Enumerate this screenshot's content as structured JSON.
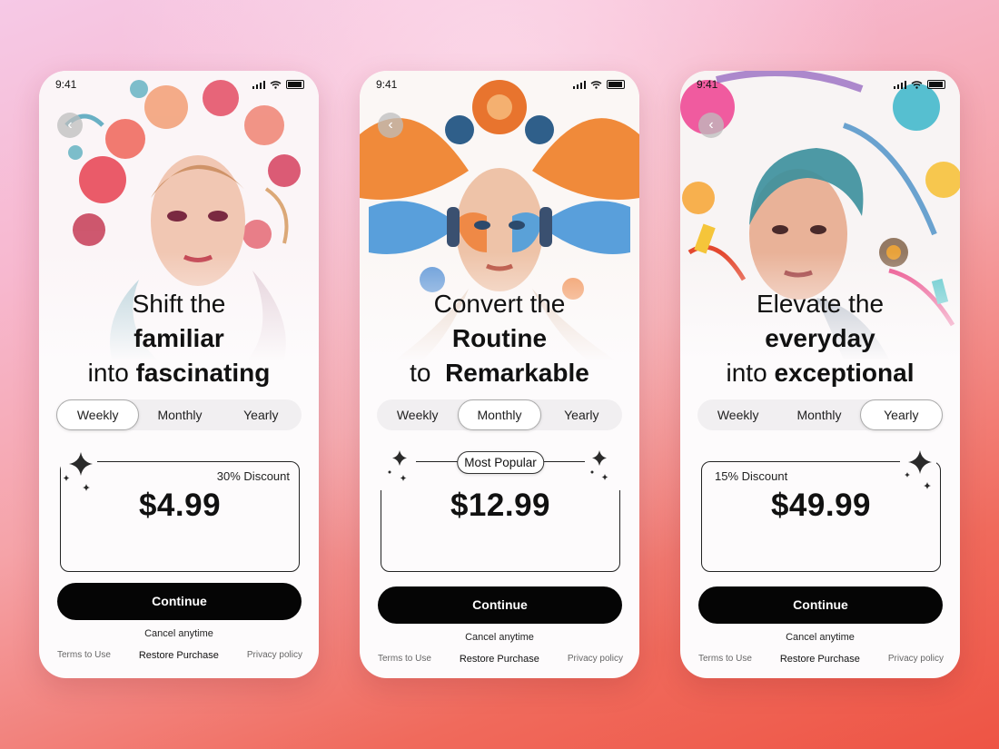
{
  "screens": [
    {
      "time": "9:41",
      "headline": {
        "line1": "Shift the",
        "line2": "familiar",
        "line3_pre": "into",
        "line3_bold": "fascinating"
      },
      "tabs": [
        "Weekly",
        "Monthly",
        "Yearly"
      ],
      "selected_tab": "Weekly",
      "discount": "30% Discount",
      "price": "$4.99",
      "cta": "Continue",
      "cancel": "Cancel anytime",
      "footer": {
        "terms": "Terms to Use",
        "restore": "Restore Purchase",
        "privacy": "Privacy policy"
      }
    },
    {
      "time": "9:41",
      "headline": {
        "line1": "Convert the",
        "line2": "Routine",
        "line3_pre": "to",
        "line3_bold": "Remarkable"
      },
      "tabs": [
        "Weekly",
        "Monthly",
        "Yearly"
      ],
      "selected_tab": "Monthly",
      "badge": "Most Popular",
      "price": "$12.99",
      "cta": "Continue",
      "cancel": "Cancel anytime",
      "footer": {
        "terms": "Terms to Use",
        "restore": "Restore Purchase",
        "privacy": "Privacy policy"
      }
    },
    {
      "time": "9:41",
      "headline": {
        "line1": "Elevate the",
        "line2": "everyday",
        "line3_pre": "into",
        "line3_bold": "exceptional"
      },
      "tabs": [
        "Weekly",
        "Monthly",
        "Yearly"
      ],
      "selected_tab": "Yearly",
      "discount": "15% Discount",
      "price": "$49.99",
      "cta": "Continue",
      "cancel": "Cancel anytime",
      "footer": {
        "terms": "Terms to Use",
        "restore": "Restore Purchase",
        "privacy": "Privacy policy"
      }
    }
  ],
  "icons": {
    "back": "chevron-left-icon",
    "sparkle": "sparkle-icon",
    "signal": "signal-icon",
    "wifi": "wifi-icon",
    "battery": "battery-icon"
  },
  "colors": {
    "cta": "#050505",
    "background_top": "#f6c9e6",
    "background_bottom": "#ee5444"
  }
}
